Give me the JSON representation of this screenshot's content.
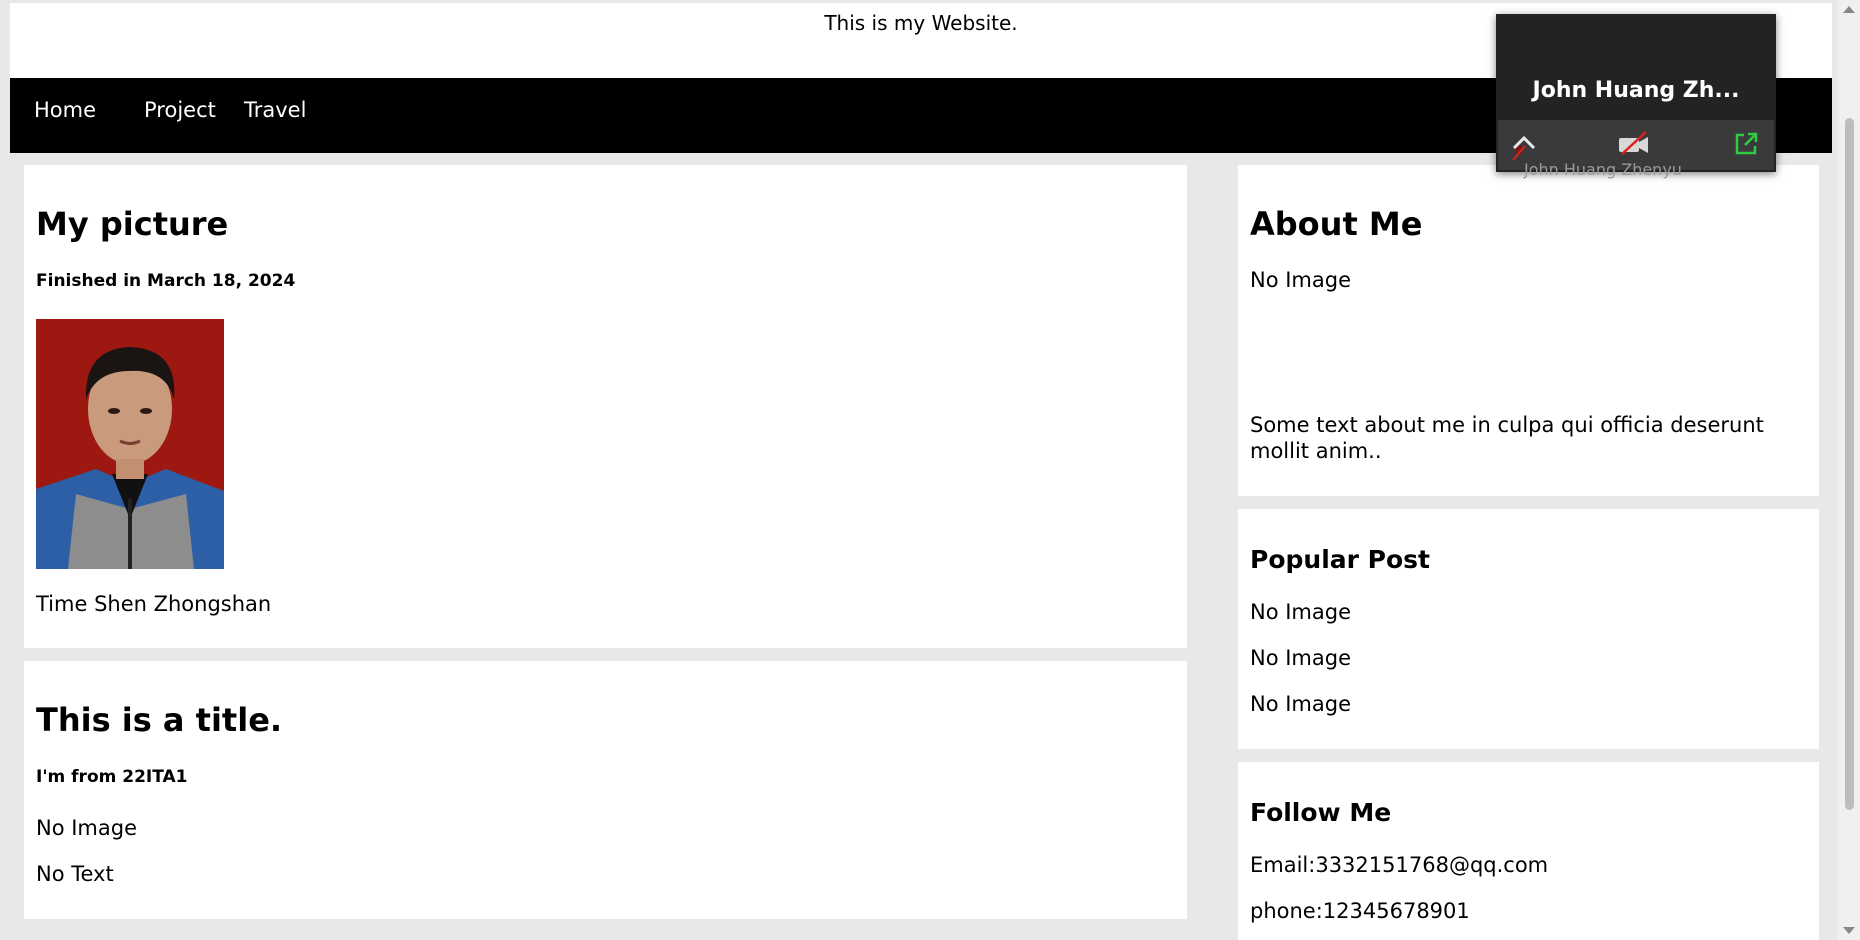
{
  "header": {
    "tagline": "This is my Website."
  },
  "nav": {
    "items": [
      "Home",
      "Project",
      "Travel"
    ]
  },
  "main": {
    "card1": {
      "title": "My picture",
      "date": "Finished in March 18, 2024",
      "caption": "Time Shen Zhongshan"
    },
    "card2": {
      "title": "This is a title.",
      "subtitle": "I'm from 22ITA1",
      "line1": "No Image",
      "line2": "No Text"
    }
  },
  "sidebar": {
    "about": {
      "title": "About Me",
      "image_text": "No Image",
      "text": "Some text about me in culpa qui officia deserunt mollit anim.."
    },
    "popular": {
      "title": "Popular Post",
      "items": [
        "No Image",
        "No Image",
        "No Image"
      ]
    },
    "follow": {
      "title": "Follow Me",
      "email": "Email:3332151768@qq.com",
      "phone": "phone:12345678901"
    }
  },
  "zoom_overlay": {
    "name": "John Huang Zh...",
    "subname": "John Huang Zhenyu",
    "icons": [
      "chevron-up-icon",
      "video-off-icon",
      "popout-icon",
      "mic-off-icon"
    ]
  },
  "colors": {
    "nav_bg": "#000000",
    "page_bg": "#e8e8e8",
    "card_bg": "#ffffff",
    "overlay_bg": "#232323",
    "accent_green": "#2ecc40",
    "mute_red": "#e02020"
  }
}
